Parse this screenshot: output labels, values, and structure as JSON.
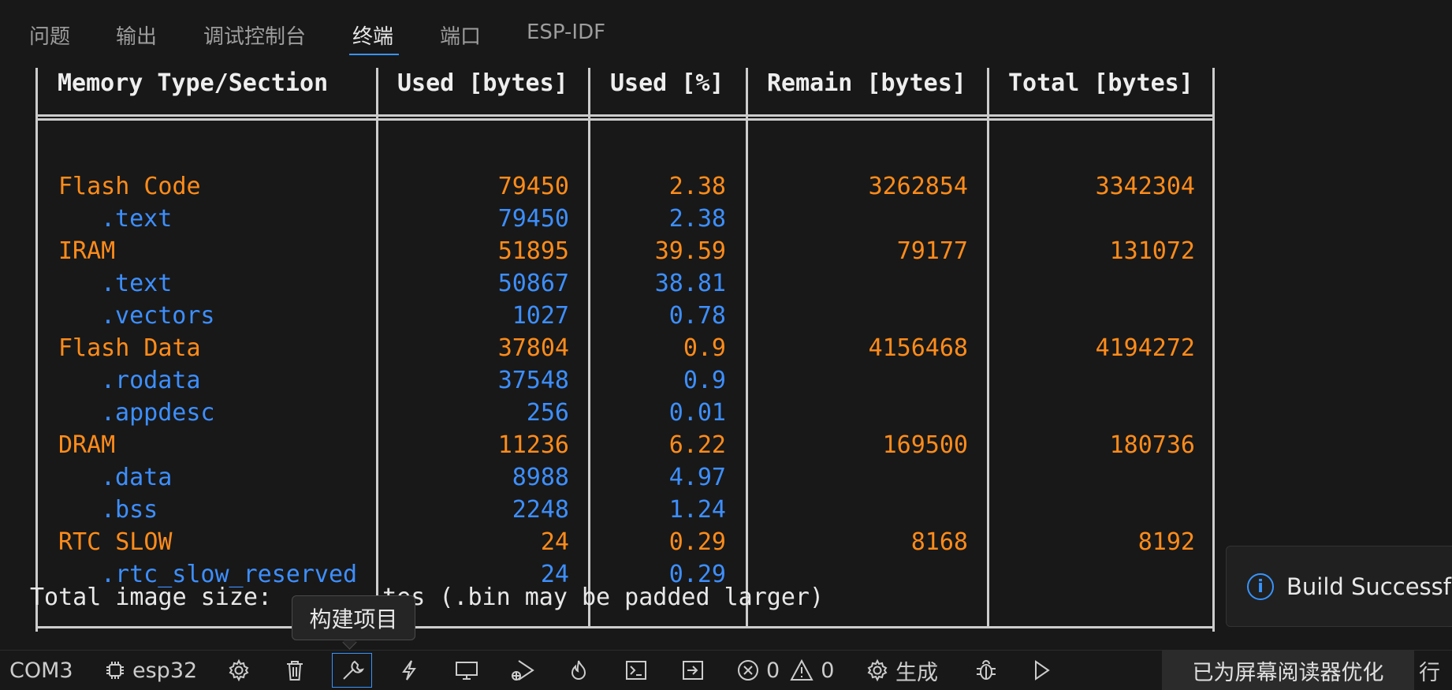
{
  "panel": {
    "tabs": [
      {
        "label": "问题"
      },
      {
        "label": "输出"
      },
      {
        "label": "调试控制台"
      },
      {
        "label": "终端"
      },
      {
        "label": "端口"
      },
      {
        "label": "ESP-IDF"
      }
    ],
    "active_tab": "终端"
  },
  "terminal": {
    "table": {
      "headers": [
        "Memory Type/Section",
        "Used [bytes]",
        "Used [%]",
        "Remain [bytes]",
        "Total [bytes]"
      ],
      "rows": [
        {
          "name": "Flash Code",
          "used": "79450",
          "pct": "2.38",
          "remain": "3262854",
          "total": "3342304",
          "kind": "section"
        },
        {
          "name": ".text",
          "used": "79450",
          "pct": "2.38",
          "remain": "",
          "total": "",
          "kind": "sub"
        },
        {
          "name": "IRAM",
          "used": "51895",
          "pct": "39.59",
          "remain": "79177",
          "total": "131072",
          "kind": "section"
        },
        {
          "name": ".text",
          "used": "50867",
          "pct": "38.81",
          "remain": "",
          "total": "",
          "kind": "sub"
        },
        {
          "name": ".vectors",
          "used": "1027",
          "pct": "0.78",
          "remain": "",
          "total": "",
          "kind": "sub"
        },
        {
          "name": "Flash Data",
          "used": "37804",
          "pct": "0.9",
          "remain": "4156468",
          "total": "4194272",
          "kind": "section"
        },
        {
          "name": ".rodata",
          "used": "37548",
          "pct": "0.9",
          "remain": "",
          "total": "",
          "kind": "sub"
        },
        {
          "name": ".appdesc",
          "used": "256",
          "pct": "0.01",
          "remain": "",
          "total": "",
          "kind": "sub"
        },
        {
          "name": "DRAM",
          "used": "11236",
          "pct": "6.22",
          "remain": "169500",
          "total": "180736",
          "kind": "section"
        },
        {
          "name": ".data",
          "used": "8988",
          "pct": "4.97",
          "remain": "",
          "total": "",
          "kind": "sub"
        },
        {
          "name": ".bss",
          "used": "2248",
          "pct": "1.24",
          "remain": "",
          "total": "",
          "kind": "sub"
        },
        {
          "name": "RTC SLOW",
          "used": "24",
          "pct": "0.29",
          "remain": "8168",
          "total": "8192",
          "kind": "section"
        },
        {
          "name": ".rtc_slow_reserved",
          "used": "24",
          "pct": "0.29",
          "remain": "",
          "total": "",
          "kind": "sub"
        }
      ]
    },
    "total_prefix": "Total image size: ",
    "total_suffix": "tes (.bin may be padded larger)"
  },
  "tooltip": {
    "text": "构建项目"
  },
  "notification": {
    "text": "Build Successfu"
  },
  "statusbar": {
    "port": "COM3",
    "target": "esp32",
    "errors": "0",
    "warnings": "0",
    "build_label": "生成",
    "screen_reader": "已为屏幕阅读器优化",
    "line": "行 "
  },
  "colors": {
    "section": "#ff8c1a",
    "subsection": "#3d8fff",
    "accent": "#3794ff",
    "background": "#181818"
  },
  "icons": [
    "chip-icon",
    "gear-icon",
    "trash-icon",
    "wrench-icon",
    "flash-icon",
    "monitor-icon",
    "debug-run-icon",
    "flame-icon",
    "terminal-icon",
    "enter-icon",
    "error-icon",
    "warning-icon",
    "bug-icon",
    "play-icon",
    "info-icon"
  ]
}
